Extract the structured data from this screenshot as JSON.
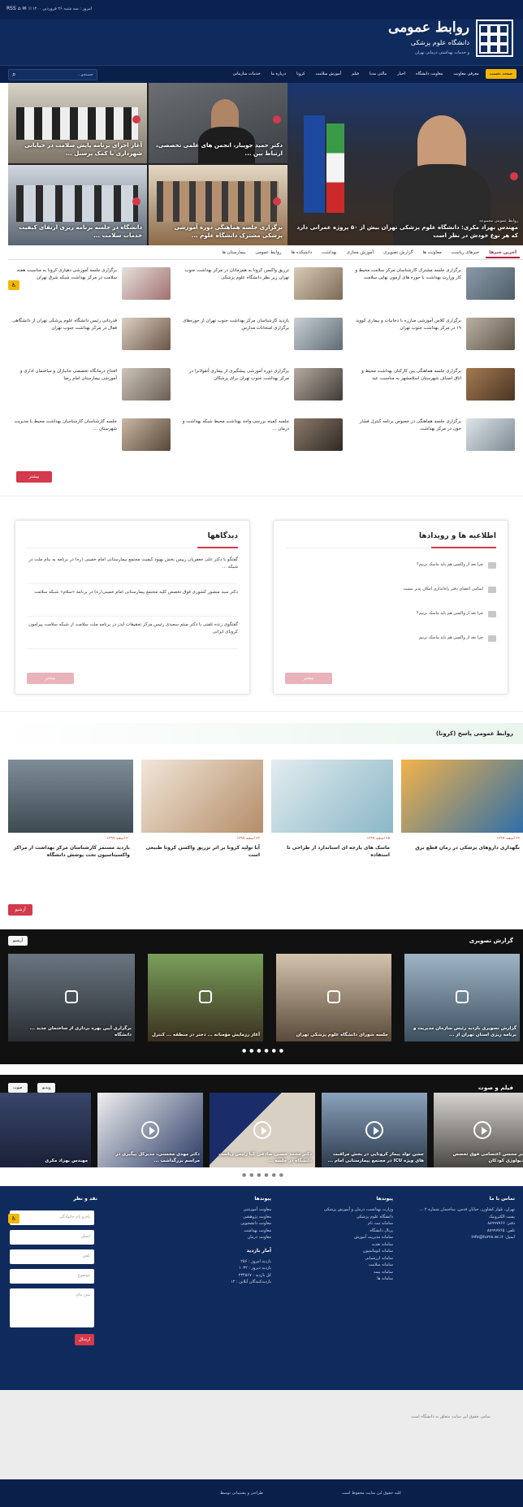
{
  "header": {
    "date": "امروز : سه شنبه ۲۶ فروردین ۱۴۰۰",
    "icons": "RSS ⌂ ✉ ☆",
    "logo_title": "روابط عمومی",
    "logo_subtitle": "دانشگاه علوم پزشکی",
    "logo_subtitle2": "و خدمات بهداشتی درمانی تهران"
  },
  "nav": {
    "items": [
      "صفحه نخست",
      "معرفی معاونت",
      "معاونت دانشگاه",
      "اخبار",
      "مالتی مدیا",
      "فیلم",
      "آموزش سلامت",
      "کرونا",
      "درباره ما",
      "خدمات سازمانی"
    ],
    "search_placeholder": "جستجو...",
    "search_icon": "⌕"
  },
  "hero": {
    "main_caption": "مهندس بهزاد مکری: دانشگاه علوم پزشکی تهران بیش از ۵۰ پروژه عمرانی دارد که هر نوع خودش در نظر است",
    "main_tag": "روابط عمومی مجموعه",
    "cells": [
      {
        "caption": "دکتر حمید جویبار، انجمن های علمی تخصصی، ارتباط بین ..."
      },
      {
        "caption": "آغاز اجرای برنامه پایش سلامت در خیابانی شهرداری با کمک پرسنل ..."
      },
      {
        "caption": "برگزاری جلسه هماهنگی دوره آموزشی پزشکی مشترک دانشگاه علوم ..."
      },
      {
        "caption": "دانشگاه در جلسه برنامه ریزی ارتقای کیفیت خدمات سلامت ..."
      }
    ]
  },
  "tabs": [
    "آخرین خبرها",
    "خبرهای ریاست",
    "معاونت ها",
    "گزارش تصویری",
    "آموزش مجازی",
    "بهداشت",
    "دانشکده ها",
    "روابط عمومی",
    "بیمارستان ها"
  ],
  "news": [
    "برگزاری جلسه مشترک کارشناسان مرکز سلامت محیط و کار وزارت بهداشت با حوزه های آزمون نهایی سلامت",
    "تزریق واکسن کرونا به همزمانان در مرکز بهداشت جنوب تهران زیر نظر دانشگاه علوم پزشکی",
    "برگزاری جلسه آموزشی دهیاری کرونا به مناسبت هفته سلامت در مرکز بهداشت شبکه شرق تهران",
    "برگزاری کلاس آموزشی مبارزه با دخانیات و بیماری کووید ۱۹ در مرکز بهداشت جنوب تهران",
    "بازدید کارشناسان مرکز بهداشت جنوب تهران از حوزه‌های برگزاری امتحانات مدارس",
    "قدردانی رئیس دانشگاه علوم پزشکی تهران از دانشگاهی فعال در مرکز بهداشت جنوب تهران",
    "برگزاری جلسه هماهنگی بین کارکنان بهداشت محیط و اتاق اصناف شهرستان اسلامشهر به مناسبت عید",
    "برگزاری دوره آموزشی پیشگیری از بیماری آنفولانزا در مرکز بهداشت جنوب تهران برای پزشکان",
    "افتتاح درمانگاه تخصصی جانبازان و ساختمان اداری و آموزشی بیمارستان امام رضا",
    "برگزاری جلسه هماهنگی در خصوص برنامه کنترل فشار خون در مرکز بهداشت",
    "جلسه کمیته بررسی واحد بهداشت محیط شبکه بهداشت و درمان ...",
    "جلسه کارشناسان کارشناسان بهداشت محیط با مدیریت شهرستان ..."
  ],
  "more_label": "بیشتر",
  "events": {
    "title": "اطلاعیه ها و رویدادها",
    "items": [
      "چرا بعد از واکسن هم باید ماسک بزنیم؟",
      "اسامی اعضای دفتر راه‌اندازی امکان پذیر نیست",
      "چرا بعد از واکسن هم باید ماسک بزنیم؟",
      "چرا بعد از واکسن هم باید ماسک بزنیم"
    ],
    "more": "بیشتر"
  },
  "comments": {
    "title": "دیدگاهها",
    "items": [
      "گفتگو با دکتر علی جعفریان رییس بخش بهبود کیفیت مجتمع بیمارستانی امام خمینی (ره) در برنامه به بنام ملت در شبکه ...",
      "دکتر سید منصور کشوری فوق تخصص کلیه مجتمع بیمارستانی امام خمینی(ره) در برنامه «سلام» شبکه سلامت",
      "گفتگوی زنده تلفنی با دکتر میثم سعیدی رئیس مرکز تحقیقات ایدز در برنامه ملت سلامت از شبکه سلامت پیرامون کرونای ایرانی"
    ],
    "more": "بیشتر"
  },
  "corona": {
    "title": "روابط عمومی پاسخ (کرونا)",
    "cards": [
      {
        "meta": "۲۶ اسفند ۱۳۹۹",
        "text": "نگهداری داروهای پزشکی در زمان قطع برق"
      },
      {
        "meta": "۲۵ اسفند ۱۳۹۹",
        "text": "ماسک های پارچه ای استاندارد از طراحی تا استفاده"
      },
      {
        "meta": "۲۳ اسفند ۱۳۹۹",
        "text": "آیا تولید کرونا بر اثر تزریق واکسن کرونا طبیعی است"
      },
      {
        "meta": "۲۰ اسفند ۱۳۹۹",
        "text": "بازدید مستمر کارشناسان مرکز بهداشت از مراکز واکسیناسیون تحت پوشش دانشگاه"
      }
    ],
    "more": "آرشیو"
  },
  "gallery": {
    "title": "گزارش تصویری",
    "button": "آرشیو",
    "items": [
      {
        "caption": "گزارش تصویری بازدید رئیس سازمان مدیریت و برنامه ریزی استان تهران از ..."
      },
      {
        "caption": "جلسه شورای دانشگاه علوم پزشکی تهران"
      },
      {
        "caption": "آغاز رزمایش مؤمنانه ... دختر در منطقه ... کنترل"
      },
      {
        "caption": "برگزاری آیین بهره برداری از ساختمان جدید ... دانشگاه"
      }
    ],
    "dots": "● ● ● ● ● ●"
  },
  "media": {
    "title": "فیلم و صوت",
    "buttons": [
      "صوت",
      "ویدیو"
    ],
    "items": [
      {
        "caption": "دکتر محسن اعتصامی فوق تخصص رادیولوژی کودکان"
      },
      {
        "caption": "جشن تولد بیمار کرونایی در بخش مراقبت های ویژه ICU در مجتمع بیمارستانی امام ..."
      },
      {
        "caption": "دکتر محمد حسین صادقی کیا رئیس ریاست دانشگاه در جلسه ..."
      },
      {
        "caption": "دکتر مهدی محسنی، مدیرکل پیگیری در مراسم بزرگداشت ..."
      },
      {
        "caption": "مهندس بهزاد مکری"
      }
    ],
    "dots": "● ● ● ● ● ●"
  },
  "footer": {
    "col_contact": {
      "title": "تماس با ما",
      "lines": [
        "تهران، بلوار کشاورز، خیابان قدس، ساختمان شماره ۲ ...",
        "پست الکترونیک",
        "دفتر: ۸۸۹۹۷۷۶۶",
        "تلفن: ۸۸۹۹۷۷۶۵",
        "ایمیل: info@tums.ac.ir"
      ]
    },
    "col_links1": {
      "title": "پیوندها",
      "items": [
        "وزارت بهداشت، درمان و آموزش پزشکی",
        "دانشگاه علوم پزشکی",
        "سامانه ثبت نام",
        "پرتال دانشگاه",
        "سامانه مدیریت آموزش",
        "سامانه تغذیه",
        "سامانه اتوماسیون",
        "سامانه ارزشیابی",
        "سامانه سلامت",
        "سامانه بیمه",
        "سامانه ها"
      ]
    },
    "col_links2": {
      "title": "پیوندها",
      "items": [
        "معاونت آموزشی",
        "معاونت پژوهشی",
        "معاونت دانشجویی",
        "معاونت بهداشت",
        "معاونت درمان"
      ],
      "stats_title": "آمار بازدید",
      "stats": [
        "بازدید امروز : ۲۵۶",
        "بازدید دیروز : ۱۰۳۲",
        "کل بازدید : ۲۳۴۵۶۷",
        "بازدیدکنندگان آنلاین : ۱۲"
      ]
    },
    "col_form": {
      "title": "نقد و نظر",
      "fields": [
        "نام و نام خانوادگی",
        "ایمیل",
        "تلفن",
        "موضوع"
      ],
      "textarea": "متن پیام",
      "submit": "ارسال"
    }
  },
  "legal": "تمامی حقوق این سایت متعلق به دانشگاه است",
  "bottom": [
    "کلیه حقوق این سایت محفوظ است",
    "طراحی و پشتیبانی توسط"
  ]
}
